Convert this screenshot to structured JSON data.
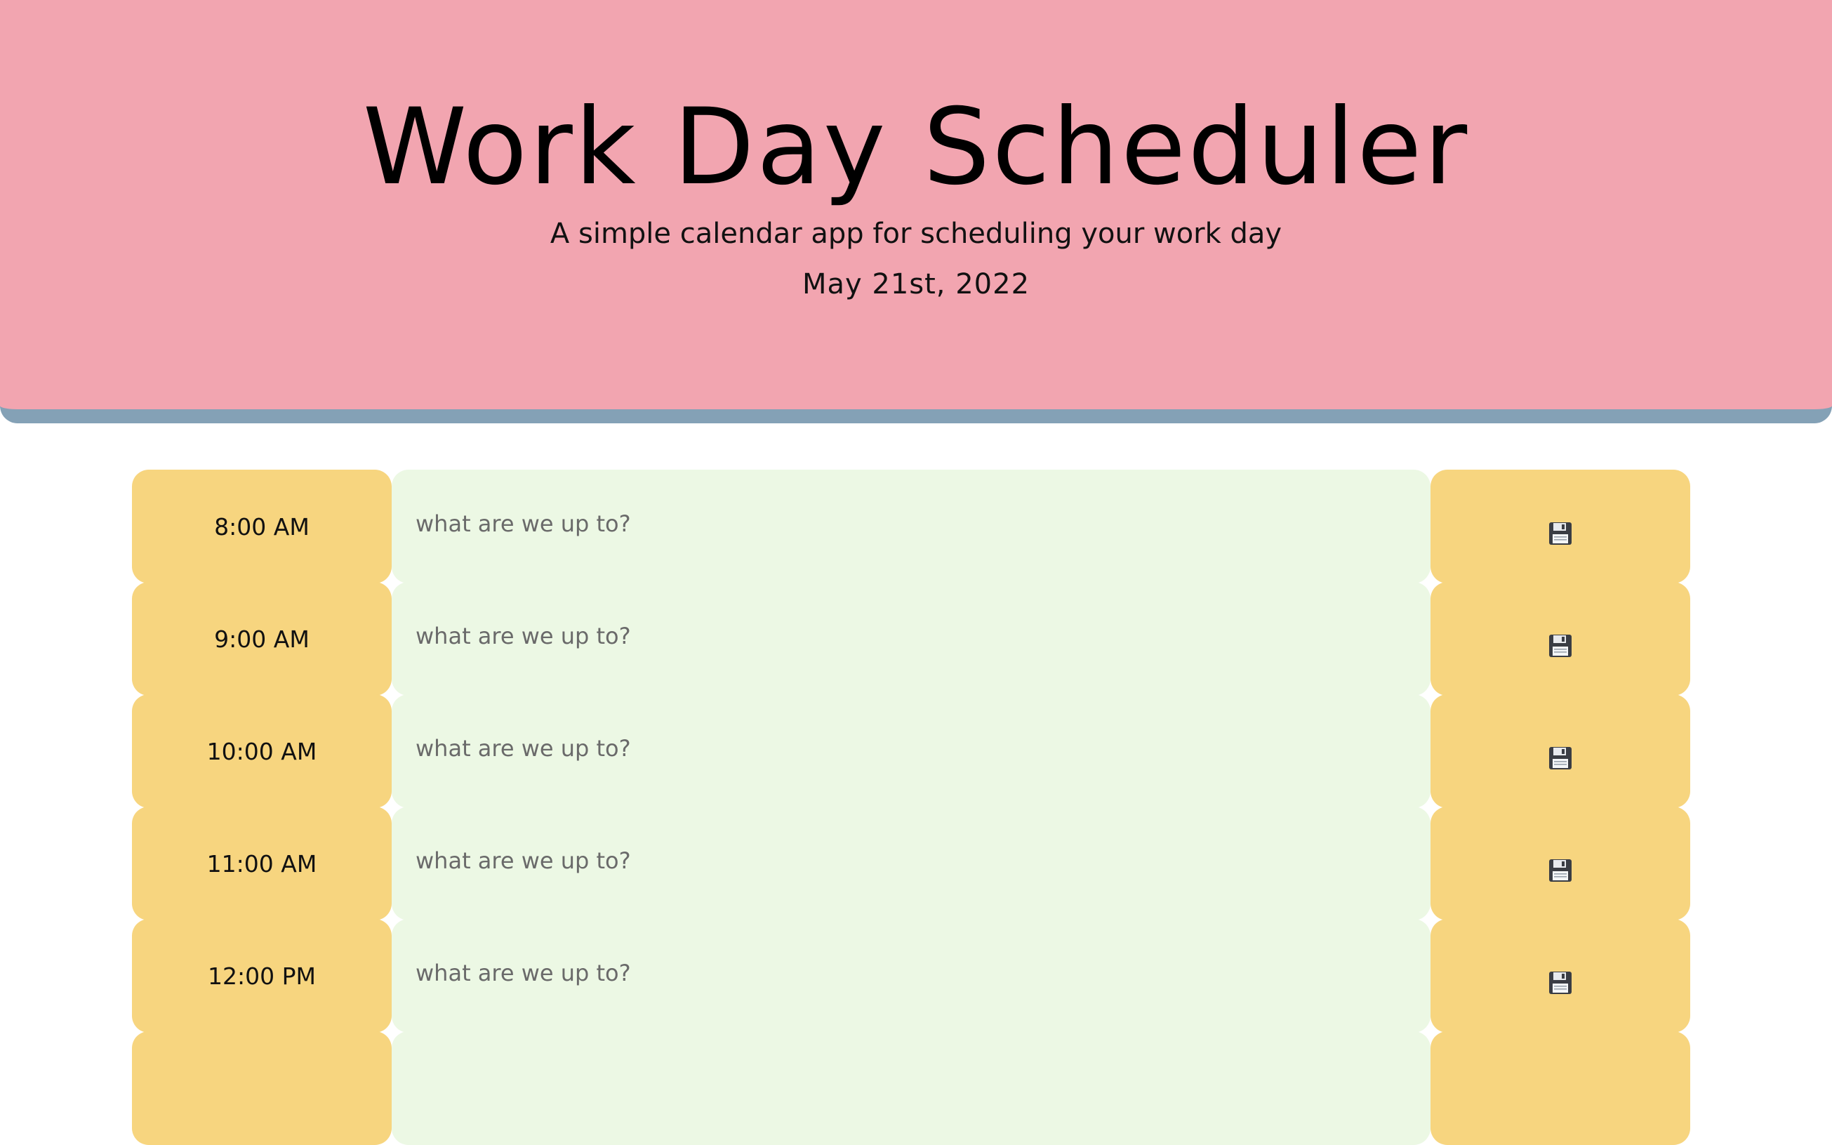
{
  "header": {
    "title": "Work Day Scheduler",
    "subtitle": "A simple calendar app for scheduling your work day",
    "current_day": "May 21st, 2022"
  },
  "timeblocks": [
    {
      "hour": "8:00 AM",
      "placeholder": "what are we up to?",
      "value": ""
    },
    {
      "hour": "9:00 AM",
      "placeholder": "what are we up to?",
      "value": ""
    },
    {
      "hour": "10:00 AM",
      "placeholder": "what are we up to?",
      "value": ""
    },
    {
      "hour": "11:00 AM",
      "placeholder": "what are we up to?",
      "value": ""
    },
    {
      "hour": "12:00 PM",
      "placeholder": "what are we up to?",
      "value": ""
    },
    {
      "hour": "",
      "placeholder": "",
      "value": ""
    }
  ],
  "icons": {
    "save": "floppy-disk-icon"
  },
  "colors": {
    "header_bg": "#f2a5b0",
    "header_border": "#84a1b6",
    "hour_bg": "#f7d57f",
    "future_bg": "#ecf8e4",
    "save_bg": "#f7d57f"
  }
}
